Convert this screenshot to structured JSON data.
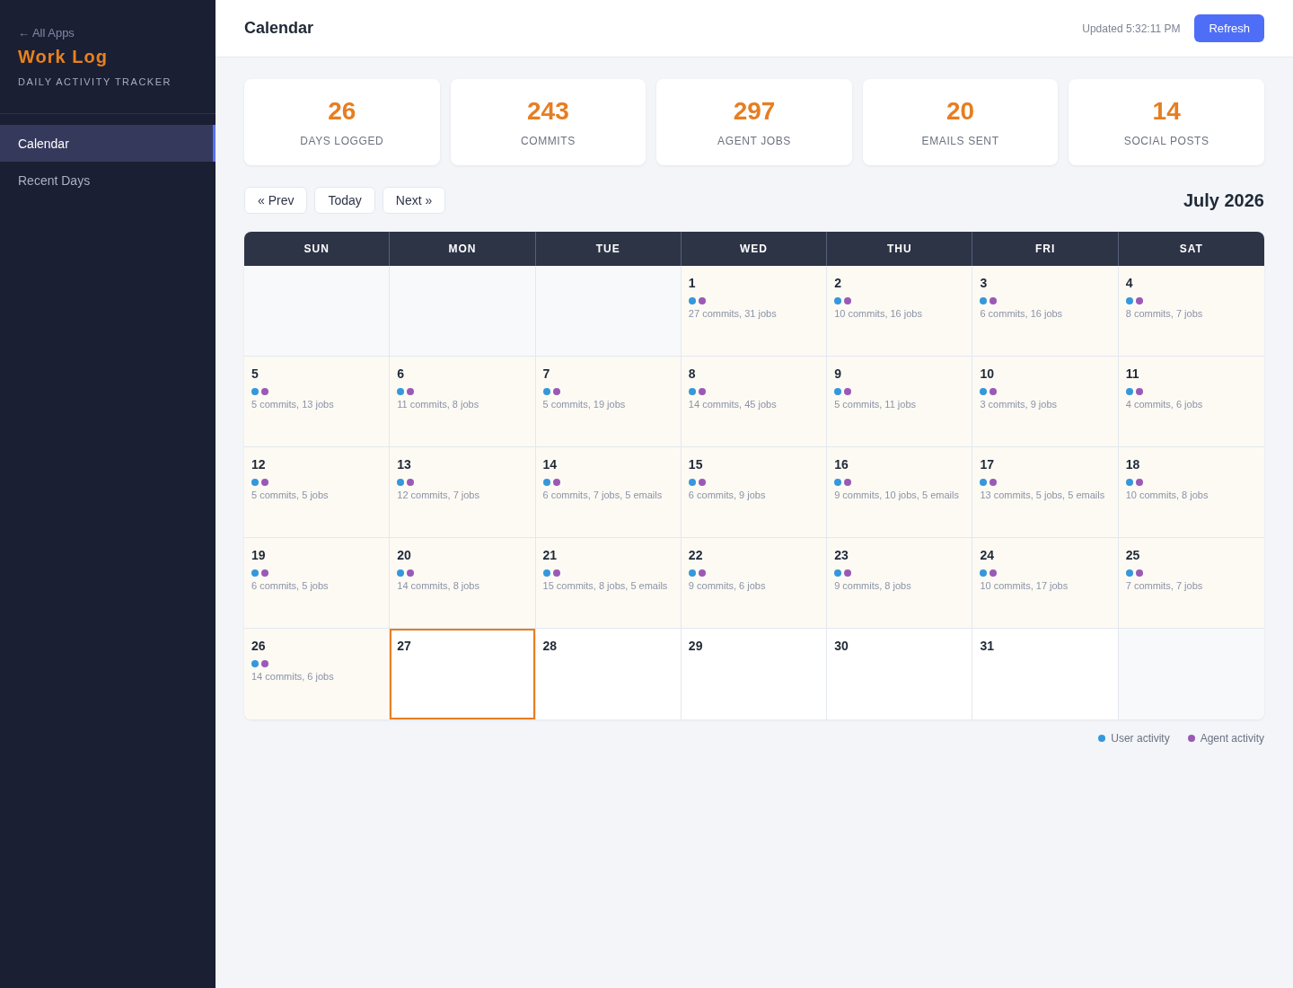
{
  "sidebar": {
    "back_link": "← All Apps",
    "title": "Work Log",
    "subtitle": "DAILY ACTIVITY TRACKER",
    "items": [
      {
        "label": "Calendar",
        "selected": true
      },
      {
        "label": "Recent Days",
        "selected": false
      }
    ]
  },
  "header": {
    "title": "Calendar",
    "updated": "Updated 5:32:11 PM",
    "refresh_button": "Refresh"
  },
  "stats": [
    {
      "value": "26",
      "label": "DAYS LOGGED"
    },
    {
      "value": "243",
      "label": "COMMITS"
    },
    {
      "value": "297",
      "label": "AGENT JOBS"
    },
    {
      "value": "20",
      "label": "EMAILS SENT"
    },
    {
      "value": "14",
      "label": "SOCIAL POSTS"
    }
  ],
  "nav": {
    "buttons": [
      "« Prev",
      "Today",
      "Next »"
    ],
    "month": "July 2026"
  },
  "calendar": {
    "weekdays": [
      "SUN",
      "MON",
      "TUE",
      "WED",
      "THU",
      "FRI",
      "SAT"
    ],
    "cells": [
      {
        "kind": "blank"
      },
      {
        "kind": "blank"
      },
      {
        "kind": "blank"
      },
      {
        "kind": "logged",
        "day": "1",
        "today": false,
        "dots": [
          {
            "color": "#3498db"
          },
          {
            "color": "#9b59b6"
          }
        ],
        "summary": "27 commits, 31 jobs"
      },
      {
        "kind": "logged",
        "day": "2",
        "today": false,
        "dots": [
          {
            "color": "#3498db"
          },
          {
            "color": "#9b59b6"
          }
        ],
        "summary": "10 commits, 16 jobs"
      },
      {
        "kind": "logged",
        "day": "3",
        "today": false,
        "dots": [
          {
            "color": "#3498db"
          },
          {
            "color": "#9b59b6"
          }
        ],
        "summary": "6 commits, 16 jobs"
      },
      {
        "kind": "logged",
        "day": "4",
        "today": false,
        "dots": [
          {
            "color": "#3498db"
          },
          {
            "color": "#9b59b6"
          }
        ],
        "summary": "8 commits, 7 jobs"
      },
      {
        "kind": "logged",
        "day": "5",
        "today": false,
        "dots": [
          {
            "color": "#3498db"
          },
          {
            "color": "#9b59b6"
          }
        ],
        "summary": "5 commits, 13 jobs"
      },
      {
        "kind": "logged",
        "day": "6",
        "today": false,
        "dots": [
          {
            "color": "#3498db"
          },
          {
            "color": "#9b59b6"
          }
        ],
        "summary": "11 commits, 8 jobs"
      },
      {
        "kind": "logged",
        "day": "7",
        "today": false,
        "dots": [
          {
            "color": "#3498db"
          },
          {
            "color": "#9b59b6"
          }
        ],
        "summary": "5 commits, 19 jobs"
      },
      {
        "kind": "logged",
        "day": "8",
        "today": false,
        "dots": [
          {
            "color": "#3498db"
          },
          {
            "color": "#9b59b6"
          }
        ],
        "summary": "14 commits, 45 jobs"
      },
      {
        "kind": "logged",
        "day": "9",
        "today": false,
        "dots": [
          {
            "color": "#3498db"
          },
          {
            "color": "#9b59b6"
          }
        ],
        "summary": "5 commits, 11 jobs"
      },
      {
        "kind": "logged",
        "day": "10",
        "today": false,
        "dots": [
          {
            "color": "#3498db"
          },
          {
            "color": "#9b59b6"
          }
        ],
        "summary": "3 commits, 9 jobs"
      },
      {
        "kind": "logged",
        "day": "11",
        "today": false,
        "dots": [
          {
            "color": "#3498db"
          },
          {
            "color": "#9b59b6"
          }
        ],
        "summary": "4 commits, 6 jobs"
      },
      {
        "kind": "logged",
        "day": "12",
        "today": false,
        "dots": [
          {
            "color": "#3498db"
          },
          {
            "color": "#9b59b6"
          }
        ],
        "summary": "5 commits, 5 jobs"
      },
      {
        "kind": "logged",
        "day": "13",
        "today": false,
        "dots": [
          {
            "color": "#3498db"
          },
          {
            "color": "#9b59b6"
          }
        ],
        "summary": "12 commits, 7 jobs"
      },
      {
        "kind": "logged",
        "day": "14",
        "today": false,
        "dots": [
          {
            "color": "#3498db"
          },
          {
            "color": "#9b59b6"
          }
        ],
        "summary": "6 commits, 7 jobs, 5 emails"
      },
      {
        "kind": "logged",
        "day": "15",
        "today": false,
        "dots": [
          {
            "color": "#3498db"
          },
          {
            "color": "#9b59b6"
          }
        ],
        "summary": "6 commits, 9 jobs"
      },
      {
        "kind": "logged",
        "day": "16",
        "today": false,
        "dots": [
          {
            "color": "#3498db"
          },
          {
            "color": "#9b59b6"
          }
        ],
        "summary": "9 commits, 10 jobs, 5 emails"
      },
      {
        "kind": "logged",
        "day": "17",
        "today": false,
        "dots": [
          {
            "color": "#3498db"
          },
          {
            "color": "#9b59b6"
          }
        ],
        "summary": "13 commits, 5 jobs, 5 emails"
      },
      {
        "kind": "logged",
        "day": "18",
        "today": false,
        "dots": [
          {
            "color": "#3498db"
          },
          {
            "color": "#9b59b6"
          }
        ],
        "summary": "10 commits, 8 jobs"
      },
      {
        "kind": "logged",
        "day": "19",
        "today": false,
        "dots": [
          {
            "color": "#3498db"
          },
          {
            "color": "#9b59b6"
          }
        ],
        "summary": "6 commits, 5 jobs"
      },
      {
        "kind": "logged",
        "day": "20",
        "today": false,
        "dots": [
          {
            "color": "#3498db"
          },
          {
            "color": "#9b59b6"
          }
        ],
        "summary": "14 commits, 8 jobs"
      },
      {
        "kind": "logged",
        "day": "21",
        "today": false,
        "dots": [
          {
            "color": "#3498db"
          },
          {
            "color": "#9b59b6"
          }
        ],
        "summary": "15 commits, 8 jobs, 5 emails"
      },
      {
        "kind": "logged",
        "day": "22",
        "today": false,
        "dots": [
          {
            "color": "#3498db"
          },
          {
            "color": "#9b59b6"
          }
        ],
        "summary": "9 commits, 6 jobs"
      },
      {
        "kind": "logged",
        "day": "23",
        "today": false,
        "dots": [
          {
            "color": "#3498db"
          },
          {
            "color": "#9b59b6"
          }
        ],
        "summary": "9 commits, 8 jobs"
      },
      {
        "kind": "logged",
        "day": "24",
        "today": false,
        "dots": [
          {
            "color": "#3498db"
          },
          {
            "color": "#9b59b6"
          }
        ],
        "summary": "10 commits, 17 jobs"
      },
      {
        "kind": "logged",
        "day": "25",
        "today": false,
        "dots": [
          {
            "color": "#3498db"
          },
          {
            "color": "#9b59b6"
          }
        ],
        "summary": "7 commits, 7 jobs"
      },
      {
        "kind": "logged",
        "day": "26",
        "today": false,
        "dots": [
          {
            "color": "#3498db"
          },
          {
            "color": "#9b59b6"
          }
        ],
        "summary": "14 commits, 6 jobs"
      },
      {
        "kind": "day",
        "day": "27",
        "today": true
      },
      {
        "kind": "day",
        "day": "28",
        "today": false
      },
      {
        "kind": "day",
        "day": "29",
        "today": false
      },
      {
        "kind": "day",
        "day": "30",
        "today": false
      },
      {
        "kind": "day",
        "day": "31",
        "today": false
      },
      {
        "kind": "blank"
      }
    ]
  },
  "legend": [
    {
      "label": "User activity",
      "color": "#3498db"
    },
    {
      "label": "Agent activity",
      "color": "#9b59b6"
    }
  ]
}
